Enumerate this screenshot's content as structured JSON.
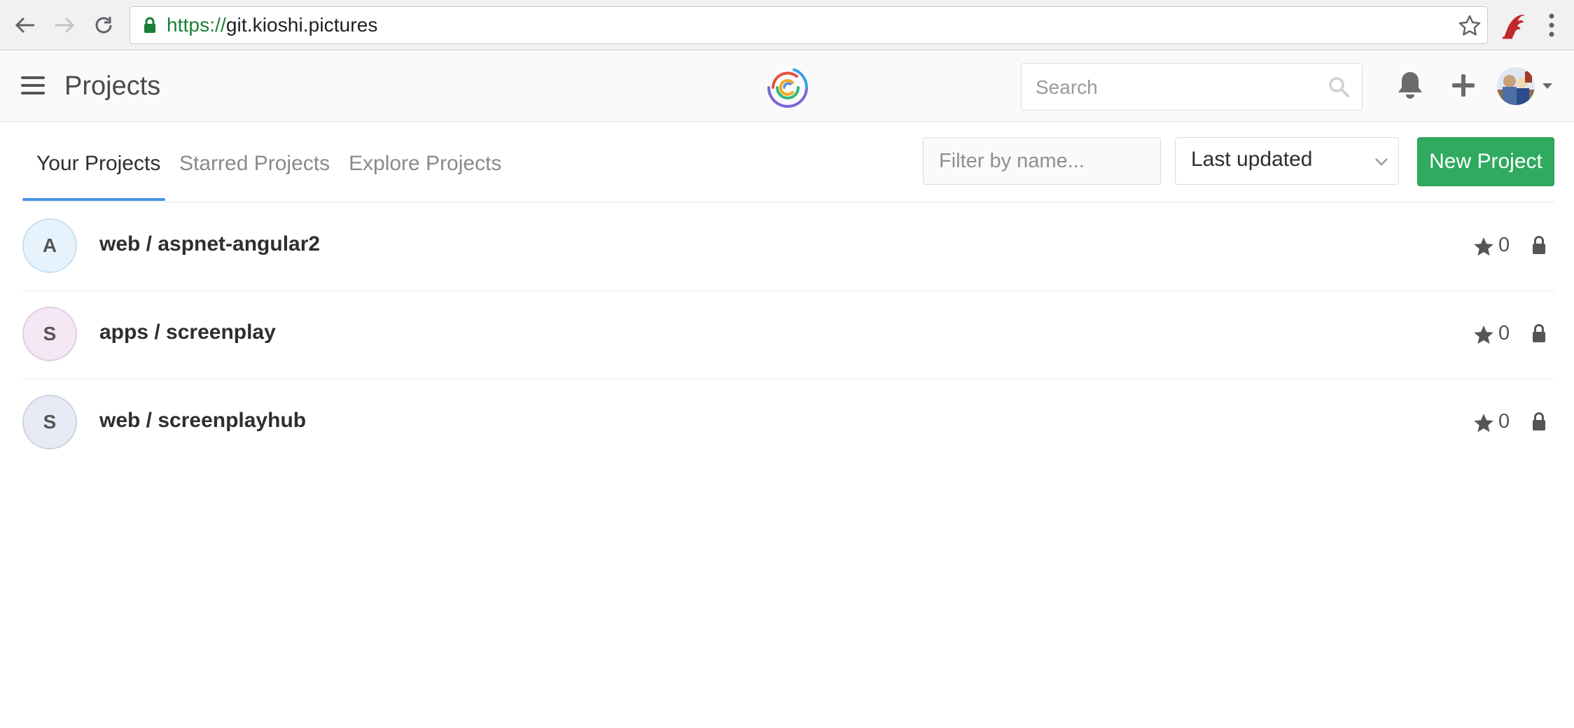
{
  "browser": {
    "url_scheme": "https://",
    "url_host": "git.kioshi.pictures"
  },
  "header": {
    "title": "Projects",
    "search_placeholder": "Search"
  },
  "tabs": [
    {
      "label": "Your Projects",
      "active": true
    },
    {
      "label": "Starred Projects",
      "active": false
    },
    {
      "label": "Explore Projects",
      "active": false
    }
  ],
  "controls": {
    "filter_placeholder": "Filter by name...",
    "sort_selected": "Last updated",
    "new_project_label": "New Project"
  },
  "projects": [
    {
      "initial": "A",
      "name": "web / aspnet-angular2",
      "stars": "0",
      "avatar_bg": "#e6f3fc",
      "avatar_border": "#c8dff0"
    },
    {
      "initial": "S",
      "name": "apps / screenplay",
      "stars": "0",
      "avatar_bg": "#f6e7f5",
      "avatar_border": "#e2cde0"
    },
    {
      "initial": "S",
      "name": "web / screenplayhub",
      "stars": "0",
      "avatar_bg": "#e8ebf5",
      "avatar_border": "#cdd2e3"
    }
  ],
  "colors": {
    "accent_tab": "#4a90e2",
    "primary_button": "#2faa5f",
    "secure_green": "#1a7f37"
  }
}
